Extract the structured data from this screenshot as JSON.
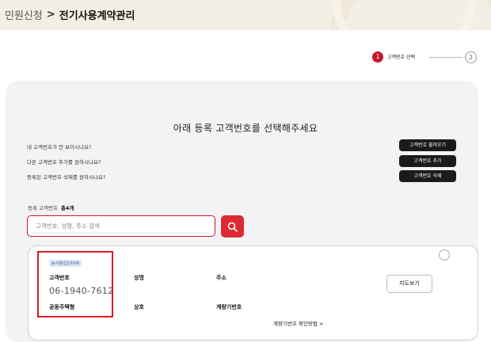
{
  "breadcrumb": {
    "parent": "민원신청",
    "separator": ">",
    "current": "전기사용계약관리"
  },
  "stepper": {
    "step1_number": "1",
    "step1_label": "고객번호 선택",
    "step2_number": "2"
  },
  "main_title": "아래 등록 고객번호를 선택해주세요",
  "questions": [
    {
      "text": "내 고객번호가 안 보이시나요?",
      "button": "고객번호 불러오기"
    },
    {
      "text": "다른 고객번호 추가를 원하시나요?",
      "button": "고객번호 추가"
    },
    {
      "text": "등록된 고객번호 삭제를 원하시나요?",
      "button": "고객번호 삭제"
    }
  ],
  "registered": {
    "label": "등록 고객번호",
    "count": "총4개"
  },
  "search": {
    "placeholder": "고객번호, 성명, 주소 검색"
  },
  "card": {
    "tag": "농사용(갑)/1kW",
    "customer_number_label": "고객번호",
    "customer_number": "06-1940-7612",
    "name_label": "성명",
    "address_label": "주소",
    "housing_label": "공동주택형",
    "company_label": "상호",
    "meter_label": "계량기번호",
    "map_button": "지도보기",
    "meter_link": "계량기번호 확인방법 >"
  },
  "colors": {
    "accent": "#c6172a",
    "search_button": "#dc2a35",
    "header_bg": "#f4efe4",
    "panel_bg": "#f3f3f3"
  }
}
